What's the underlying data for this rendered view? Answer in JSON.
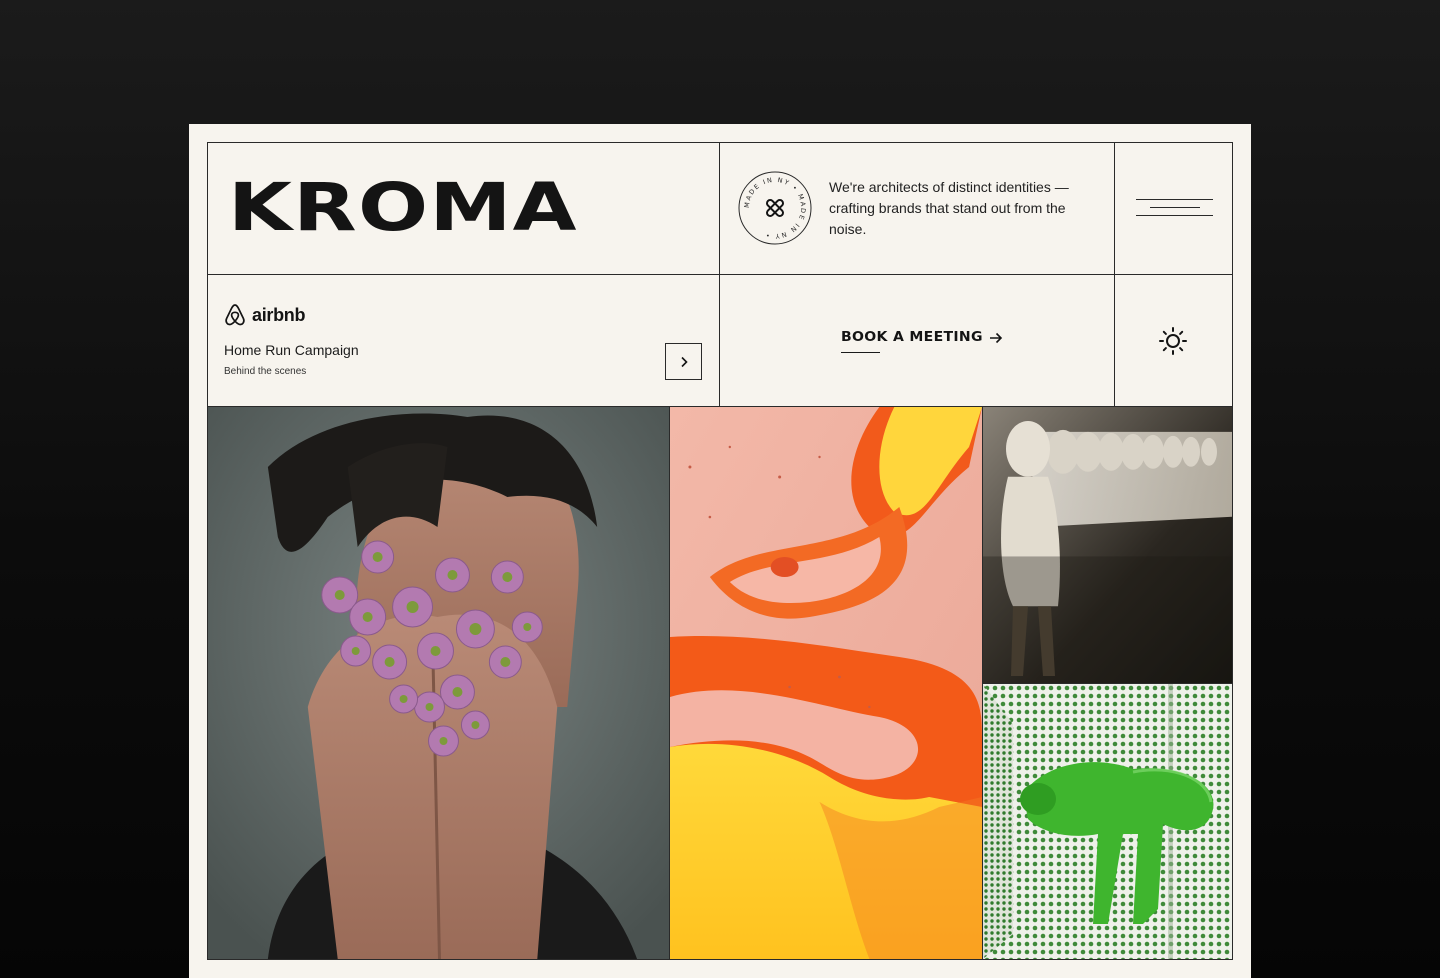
{
  "brand": {
    "logo_text": "KROMA"
  },
  "badge": {
    "text": "MADE IN NY • MADE IN NY • "
  },
  "tagline": "We're architects of distinct identities — crafting brands that stand out from the noise.",
  "menu": {
    "icon": "hamburger-icon"
  },
  "featured": {
    "client_logo_text": "airbnb",
    "title": "Home Run Campaign",
    "subtitle": "Behind the scenes",
    "next_icon": "chevron-right-icon"
  },
  "cta": {
    "label": "BOOK A MEETING",
    "icon": "arrow-right-icon"
  },
  "theme_toggle": {
    "icon": "sun-icon"
  },
  "gallery": [
    {
      "name": "portrait-flowers-image"
    },
    {
      "name": "orange-fluid-art-image"
    },
    {
      "name": "astronaut-clones-image"
    },
    {
      "name": "green-figure-tiles-image"
    }
  ],
  "colors": {
    "background": "#0c0c0c",
    "card": "#f7f4ee",
    "ink": "#141414",
    "rule": "#2a2a2a"
  }
}
